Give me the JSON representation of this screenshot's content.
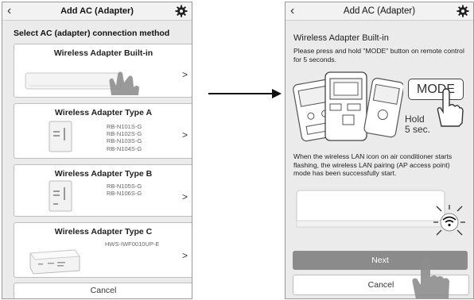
{
  "left_screen": {
    "header": {
      "title": "Add AC (Adapter)",
      "back_icon": "chevron-left-icon",
      "settings_icon": "gear-icon"
    },
    "subtitle": "Select AC (adapter) connection method",
    "options": [
      {
        "title": "Wireless Adapter Built-in",
        "models": ""
      },
      {
        "title": "Wireless Adapter Type A",
        "models": "RB-N101S-G\nRB-N102S-G\nRB-N103S-G\nRB-N104S-G"
      },
      {
        "title": "Wireless Adapter Type B",
        "models": "RB-N105S-G\nRB-N106S-G"
      },
      {
        "title": "Wireless Adapter Type C",
        "models": "HWS-IWF0010UP-E"
      }
    ],
    "cancel_label": "Cancel"
  },
  "right_screen": {
    "header": {
      "title": "Add AC (Adapter)",
      "back_icon": "chevron-left-icon",
      "settings_icon": "gear-icon"
    },
    "heading": "Wireless Adapter Built-in",
    "instruction": "Please press and hold \"MODE\" button on remote control for 5 seconds.",
    "mode_label": "MODE",
    "hold_label": "Hold\n5 sec.",
    "result_text": "When the wireless LAN icon on air conditioner starts flashing, the wireless LAN pairing (AP access point) mode has been successfully start.",
    "next_label": "Next",
    "cancel_label": "Cancel"
  },
  "colors": {
    "background": "#ebebeb",
    "card": "#ffffff",
    "next_button": "#8b8b8b"
  }
}
